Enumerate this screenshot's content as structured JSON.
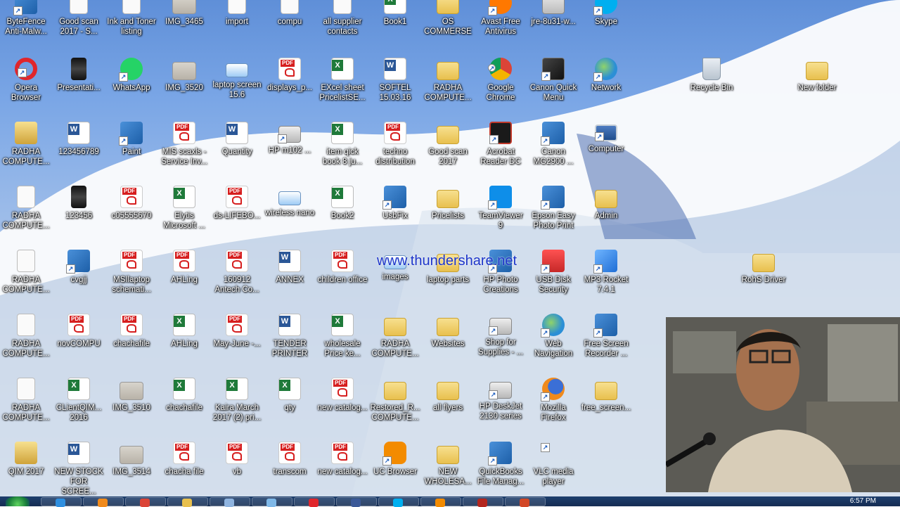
{
  "desktop": {
    "icons": [
      {
        "label": "ByteFence Anti-Malw...",
        "glyph": "app"
      },
      {
        "label": "Good scan 2017 - S...",
        "glyph": "blank"
      },
      {
        "label": "Ink and Toner listing",
        "glyph": "blank"
      },
      {
        "label": "IMG_3465",
        "glyph": "photo"
      },
      {
        "label": "import",
        "glyph": "blank"
      },
      {
        "label": "compu",
        "glyph": "blank"
      },
      {
        "label": "all supplier contacts",
        "glyph": "blank"
      },
      {
        "label": "Book1",
        "glyph": "xls"
      },
      {
        "label": "OS COMMERSE",
        "glyph": "folder"
      },
      {
        "label": "Avast Free Antivirus",
        "glyph": "avast"
      },
      {
        "label": "jre-8u31-w...",
        "glyph": "java"
      },
      {
        "label": "Skype",
        "glyph": "skype"
      },
      {
        "label": "Opera Browser",
        "glyph": "opera"
      },
      {
        "label": "Presentati...",
        "glyph": "film"
      },
      {
        "label": "WhatsApp",
        "glyph": "whatsapp"
      },
      {
        "label": "IMG_3520",
        "glyph": "photo"
      },
      {
        "label": "laptop screen 15.6",
        "glyph": "scan"
      },
      {
        "label": "displays_p...",
        "glyph": "pdf"
      },
      {
        "label": "EXcel sheet PricelistSE...",
        "glyph": "xls"
      },
      {
        "label": "SOFTEL 15.03.16",
        "glyph": "doc"
      },
      {
        "label": "RADHA COMPUTE...",
        "glyph": "folder"
      },
      {
        "label": "Google Chrome",
        "glyph": "chrome"
      },
      {
        "label": "Canon Quick Menu",
        "glyph": "canon"
      },
      {
        "label": "Network",
        "glyph": "globe"
      },
      {
        "label": "Recycle Bin",
        "glyph": "bin"
      },
      {
        "label": "New folder",
        "glyph": "folder"
      },
      {
        "label": "RADHA COMPUTE...",
        "glyph": "gold"
      },
      {
        "label": "123456789",
        "glyph": "doc"
      },
      {
        "label": "Paint",
        "glyph": "app"
      },
      {
        "label": "MIS scaxls - Service Inv...",
        "glyph": "pdf"
      },
      {
        "label": "Quantity",
        "glyph": "doc"
      },
      {
        "label": "HP m102 ...",
        "glyph": "printer"
      },
      {
        "label": "item qick book 8 ju...",
        "glyph": "xls"
      },
      {
        "label": "techno distribution",
        "glyph": "pdf"
      },
      {
        "label": "Good scan 2017",
        "glyph": "folder"
      },
      {
        "label": "Acrobat Reader DC",
        "glyph": "adobe"
      },
      {
        "label": "Canon MG2900 ...",
        "glyph": "app"
      },
      {
        "label": "Computer",
        "glyph": "monitor"
      },
      {
        "label": "RADHA COMPUTE...",
        "glyph": "blank"
      },
      {
        "label": "123456",
        "glyph": "film"
      },
      {
        "label": "c05555670",
        "glyph": "pdf"
      },
      {
        "label": "Elytis Microsoft ...",
        "glyph": "xls"
      },
      {
        "label": "ds-LIFEBO...",
        "glyph": "pdf"
      },
      {
        "label": "wireless nano",
        "glyph": "scan"
      },
      {
        "label": "Book2",
        "glyph": "xls"
      },
      {
        "label": "UsbFix",
        "glyph": "app"
      },
      {
        "label": "Pricelists",
        "glyph": "folder"
      },
      {
        "label": "TeamViewer 9",
        "glyph": "team"
      },
      {
        "label": "Epson Easy Photo Print",
        "glyph": "app"
      },
      {
        "label": "Admin",
        "glyph": "folder"
      },
      {
        "label": "RADHA COMPUTE...",
        "glyph": "blank"
      },
      {
        "label": "cvgjj",
        "glyph": "app"
      },
      {
        "label": "MSIlaptop schemati...",
        "glyph": "pdf"
      },
      {
        "label": "AHLing",
        "glyph": "pdf"
      },
      {
        "label": "160912 Antech Co...",
        "glyph": "pdf"
      },
      {
        "label": "ANNEX",
        "glyph": "doc"
      },
      {
        "label": "children office",
        "glyph": "pdf"
      },
      {
        "label": "images",
        "glyph": "scan"
      },
      {
        "label": "laptop parts",
        "glyph": "folder"
      },
      {
        "label": "HP Photo Creations",
        "glyph": "app"
      },
      {
        "label": "USB Disk Security",
        "glyph": "usb"
      },
      {
        "label": "MP3 Rocket 7.4.1",
        "glyph": "rocket"
      },
      {
        "label": "RohS Driver",
        "glyph": "folder"
      },
      {
        "label": "RADHA COMPUTE...",
        "glyph": "blank"
      },
      {
        "label": "novCOMPU",
        "glyph": "pdf"
      },
      {
        "label": "chachafile",
        "glyph": "pdf"
      },
      {
        "label": "AHLing",
        "glyph": "xls"
      },
      {
        "label": "May-June -...",
        "glyph": "pdf"
      },
      {
        "label": "TENDER PRINTER",
        "glyph": "doc"
      },
      {
        "label": "wholesale Price ke...",
        "glyph": "xls"
      },
      {
        "label": "RADHA COMPUTE...",
        "glyph": "folder"
      },
      {
        "label": "Websites",
        "glyph": "folder"
      },
      {
        "label": "Shop for Supplies - ...",
        "glyph": "printer"
      },
      {
        "label": "Web Navigation",
        "glyph": "globe"
      },
      {
        "label": "Free Screen Recorder ...",
        "glyph": "app"
      },
      {
        "label": "RADHA COMPUTE...",
        "glyph": "blank"
      },
      {
        "label": "CLientQIM... 2016",
        "glyph": "xls"
      },
      {
        "label": "IMG_3510",
        "glyph": "photo"
      },
      {
        "label": "chachafile",
        "glyph": "xls"
      },
      {
        "label": "Kaira March 2017 (2) pri...",
        "glyph": "xls"
      },
      {
        "label": "qty",
        "glyph": "xls"
      },
      {
        "label": "new catalog...",
        "glyph": "pdf"
      },
      {
        "label": "Restored_R... COMPUTE...",
        "glyph": "folder"
      },
      {
        "label": "all flyers",
        "glyph": "folder"
      },
      {
        "label": "HP DeskJet 2130 series",
        "glyph": "printer"
      },
      {
        "label": "Mozilla Firefox",
        "glyph": "firefox"
      },
      {
        "label": "free_screen...",
        "glyph": "folder"
      },
      {
        "label": "QIM 2017",
        "glyph": "gold"
      },
      {
        "label": "NEW STOCK FOR SCREE...",
        "glyph": "doc"
      },
      {
        "label": "IMG_3514",
        "glyph": "photo"
      },
      {
        "label": "chacha file",
        "glyph": "pdf"
      },
      {
        "label": "vb",
        "glyph": "pdf"
      },
      {
        "label": "transcom",
        "glyph": "pdf"
      },
      {
        "label": "new catalog...",
        "glyph": "pdf"
      },
      {
        "label": "UC Browser",
        "glyph": "uc"
      },
      {
        "label": "NEW WHOLESA...",
        "glyph": "folder"
      },
      {
        "label": "QuickBooks File Manag...",
        "glyph": "app"
      },
      {
        "label": "VLC media player",
        "glyph": "vlc"
      }
    ]
  },
  "watermark": "www.thundershare.net",
  "taskbar": {
    "clock": "6:57 PM",
    "buttons": [
      {
        "name": "ie-icon",
        "color": "#2f8fe0"
      },
      {
        "name": "firefox-icon",
        "color": "#f08a1c"
      },
      {
        "name": "chrome-icon",
        "color": "#db4437"
      },
      {
        "name": "folder-icon",
        "color": "#e8c04e"
      },
      {
        "name": "window-icon",
        "color": "#8fb4e0"
      },
      {
        "name": "paint-icon",
        "color": "#7fb8e8"
      },
      {
        "name": "opera-icon",
        "color": "#e0262c"
      },
      {
        "name": "facebook-icon",
        "color": "#3b5998"
      },
      {
        "name": "skype-icon",
        "color": "#00aff0"
      },
      {
        "name": "uc-browser-icon",
        "color": "#f38b00"
      },
      {
        "name": "acrobat-icon",
        "color": "#b3261e"
      },
      {
        "name": "powerpoint-icon",
        "color": "#d24726"
      }
    ]
  }
}
